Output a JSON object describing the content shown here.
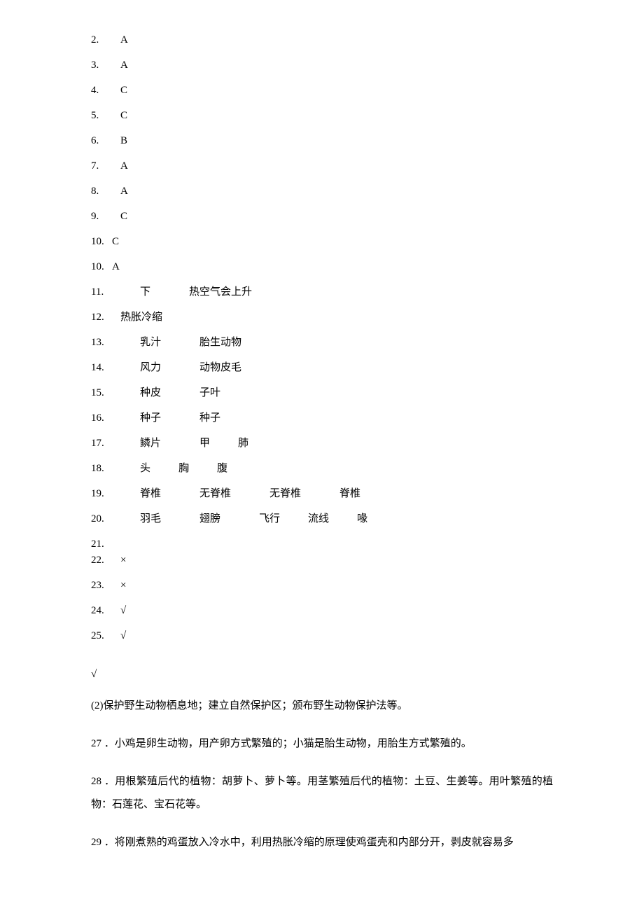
{
  "answers_simple": [
    {
      "n": "2.",
      "v": "A"
    },
    {
      "n": "3.",
      "v": "A"
    },
    {
      "n": "4.",
      "v": "C"
    },
    {
      "n": "5.",
      "v": "C"
    },
    {
      "n": "6.",
      "v": "B"
    },
    {
      "n": "7.",
      "v": "A"
    },
    {
      "n": "8.",
      "v": "A"
    },
    {
      "n": "9.",
      "v": "C"
    },
    {
      "n": "10.",
      "v": "C"
    },
    {
      "n": "10.",
      "v": "A"
    }
  ],
  "fill": [
    {
      "n": "11.",
      "parts": [
        "下",
        "热空气会上升"
      ]
    },
    {
      "n": "12.",
      "parts": [
        "热胀冷缩"
      ],
      "inline": true
    },
    {
      "n": "13.",
      "parts": [
        "乳汁",
        "胎生动物"
      ]
    },
    {
      "n": "14.",
      "parts": [
        "风力",
        "动物皮毛"
      ]
    },
    {
      "n": "15.",
      "parts": [
        "种皮",
        "子叶"
      ]
    },
    {
      "n": "16.",
      "parts": [
        "种子",
        "种子"
      ]
    },
    {
      "n": "17.",
      "parts": [
        "鳞片",
        "甲",
        "肺"
      ],
      "short": true
    },
    {
      "n": "18.",
      "parts": [
        "头",
        "胸",
        "腹"
      ],
      "short": true
    },
    {
      "n": "19.",
      "parts": [
        "脊椎",
        "无脊椎",
        "无脊椎",
        "脊椎"
      ]
    },
    {
      "n": "20.",
      "parts": [
        "羽毛",
        "翅膀",
        "飞行",
        "流线",
        "喙"
      ],
      "short": true
    }
  ],
  "tf_block": {
    "n21": "21.",
    "n22": "22.",
    "v22": "×",
    "rows": [
      {
        "n": "23.",
        "v": "×"
      },
      {
        "n": "24.",
        "v": "√"
      },
      {
        "n": "25.",
        "v": "√"
      }
    ]
  },
  "solo_mark": "√",
  "paras": [
    "(2)保护野生动物栖息地；建立自然保护区；颁布野生动物保护法等。",
    "27 ．小鸡是卵生动物，用产卵方式繁殖的；小猫是胎生动物，用胎生方式繁殖的。",
    "28 ．用根繁殖后代的植物：胡萝卜、萝卜等。用茎繁殖后代的植物：土豆、生姜等。用叶繁殖的植物：石莲花、宝石花等。",
    "29 ．将刚煮熟的鸡蛋放入冷水中，利用热胀冷缩的原理使鸡蛋壳和内部分开，剥皮就容易多"
  ]
}
